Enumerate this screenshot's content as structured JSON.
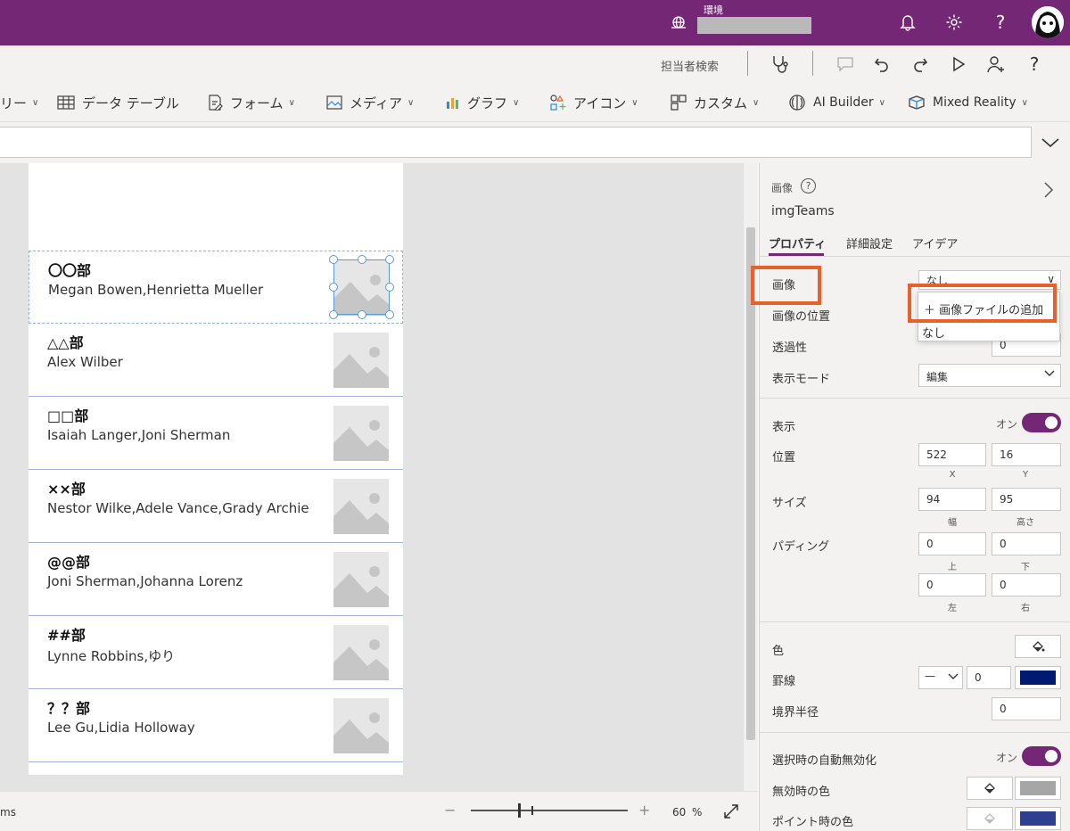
{
  "topbar": {
    "env_label": "環境",
    "bg_color": "#742774"
  },
  "command_bar": {
    "search_label": "担当者検索"
  },
  "ribbon": {
    "items": [
      {
        "label": "リー",
        "icon": "gallery-icon"
      },
      {
        "label": "データ テーブル",
        "icon": "table-icon"
      },
      {
        "label": "フォーム",
        "icon": "form-icon"
      },
      {
        "label": "メディア",
        "icon": "media-icon"
      },
      {
        "label": "グラフ",
        "icon": "chart-icon"
      },
      {
        "label": "アイコン",
        "icon": "icons-icon"
      },
      {
        "label": "カスタム",
        "icon": "custom-icon"
      },
      {
        "label": "AI Builder",
        "icon": "ai-builder-icon"
      },
      {
        "label": "Mixed Reality",
        "icon": "mixed-reality-icon"
      }
    ]
  },
  "gallery": {
    "rows": [
      {
        "title": "〇〇部",
        "members": "Megan Bowen,Henrietta Mueller"
      },
      {
        "title": "△△部",
        "members": "Alex Wilber"
      },
      {
        "title": "□□部",
        "members": "Isaiah Langer,Joni Sherman"
      },
      {
        "title": "××部",
        "members": "Nestor Wilke,Adele Vance,Grady Archie"
      },
      {
        "title": "@@部",
        "members": "Joni Sherman,Johanna Lorenz"
      },
      {
        "title": "##部",
        "members": "Lynne Robbins,ゆり"
      },
      {
        "title": "？？部",
        "members": "Lee Gu,Lidia Holloway"
      }
    ]
  },
  "statusbar": {
    "left_text": "ms",
    "zoom_value": "60",
    "zoom_unit": "%",
    "minus": "−",
    "plus": "+"
  },
  "panel": {
    "type_label": "画像",
    "control_name": "imgTeams",
    "tabs": [
      "プロパティ",
      "詳細設定",
      "アイデア"
    ],
    "image": {
      "label": "画像",
      "value": "なし"
    },
    "image_dropdown": {
      "add_option": "＋ 画像ファイルの追加",
      "none_option": "なし"
    },
    "image_position": {
      "label": "画像の位置"
    },
    "transparency": {
      "label": "透過性",
      "value": "0"
    },
    "display_mode": {
      "label": "表示モード",
      "value": "編集"
    },
    "visible": {
      "label": "表示",
      "state": "オン"
    },
    "position": {
      "label": "位置",
      "x": "522",
      "y": "16",
      "x_label": "X",
      "y_label": "Y"
    },
    "size": {
      "label": "サイズ",
      "width": "94",
      "height": "95",
      "width_label": "幅",
      "height_label": "高さ"
    },
    "padding": {
      "label": "パディング",
      "top": "0",
      "bottom": "0",
      "left": "0",
      "right": "0",
      "top_label": "上",
      "bottom_label": "下",
      "left_label": "左",
      "right_label": "右"
    },
    "color": {
      "label": "色"
    },
    "border": {
      "label": "罫線",
      "style": "—",
      "width": "0",
      "color": "#001a72"
    },
    "radius": {
      "label": "境界半径",
      "value": "0"
    },
    "auto_disable": {
      "label": "選択時の自動無効化",
      "state": "オン"
    },
    "disabled_color": {
      "label": "無効時の色",
      "color": "#a6a6a6"
    },
    "hover_color": {
      "label": "ポイント時の色",
      "color": "#2f3f8f"
    }
  },
  "colors": {
    "accent": "#742774",
    "highlight": "#e8612c",
    "selection": "#5b9bd5"
  }
}
